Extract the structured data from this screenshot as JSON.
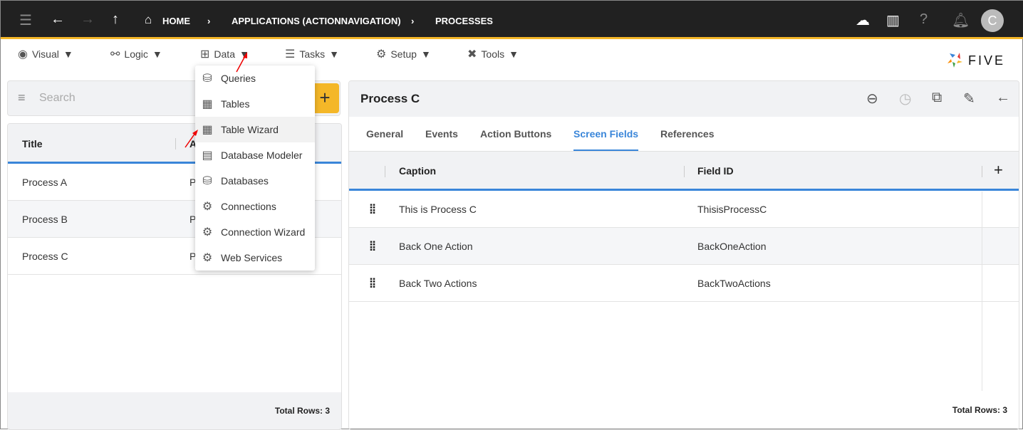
{
  "topbar": {
    "breadcrumbs": [
      "HOME",
      "APPLICATIONS (ACTIONNAVIGATION)",
      "PROCESSES"
    ],
    "avatar": "C"
  },
  "menubar": {
    "items": [
      "Visual",
      "Logic",
      "Data",
      "Tasks",
      "Setup",
      "Tools"
    ],
    "logo": "FIVE"
  },
  "data_menu": {
    "items": [
      "Queries",
      "Tables",
      "Table Wizard",
      "Database Modeler",
      "Databases",
      "Connections",
      "Connection Wizard",
      "Web Services"
    ],
    "highlighted": "Table Wizard"
  },
  "left": {
    "search_placeholder": "Search",
    "columns": [
      "Title",
      "A"
    ],
    "rows": [
      [
        "Process A",
        "P"
      ],
      [
        "Process B",
        "P"
      ],
      [
        "Process C",
        "P"
      ]
    ],
    "total": "Total Rows: 3"
  },
  "right": {
    "title": "Process C",
    "tabs": [
      "General",
      "Events",
      "Action Buttons",
      "Screen Fields",
      "References"
    ],
    "active_tab": "Screen Fields",
    "columns": [
      "Caption",
      "Field ID"
    ],
    "rows": [
      [
        "This is Process C",
        "ThisisProcessC"
      ],
      [
        "Back One Action",
        "BackOneAction"
      ],
      [
        "Back Two Actions",
        "BackTwoActions"
      ]
    ],
    "total": "Total Rows: 3"
  },
  "colors": {
    "accent": "#f4b728",
    "blue": "#3a86d9",
    "topbar": "#212121"
  }
}
